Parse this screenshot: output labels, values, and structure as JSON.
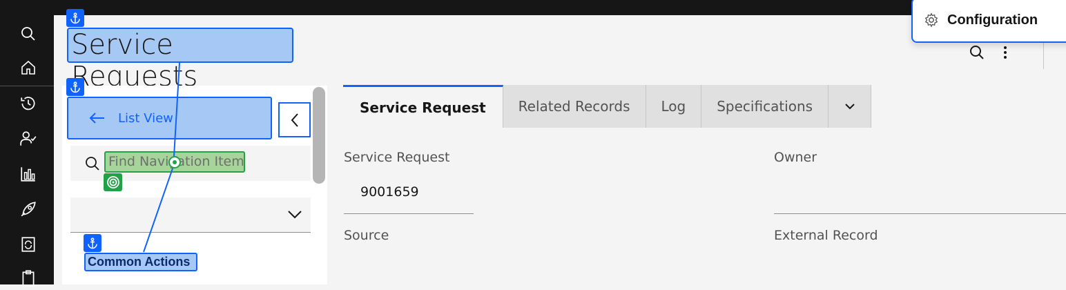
{
  "page": {
    "title": "Service Requests"
  },
  "rail": {
    "icons": [
      "search-icon",
      "home-icon",
      "recent-icon",
      "user-check-icon",
      "report-icon",
      "rocket-icon",
      "refresh-icon",
      "clipboard-icon"
    ]
  },
  "nav": {
    "list_view_label": "List View",
    "search_placeholder": "Find Navigation Item",
    "section_label": "Common Actions"
  },
  "tabs": [
    {
      "label": "Service Request",
      "active": true
    },
    {
      "label": "Related Records",
      "active": false
    },
    {
      "label": "Log",
      "active": false
    },
    {
      "label": "Specifications",
      "active": false
    }
  ],
  "form": {
    "service_request_label": "Service Request",
    "service_request_value": "9001659",
    "owner_label": "Owner",
    "source_label": "Source",
    "external_record_label": "External Record"
  },
  "popup": {
    "label": "Configuration",
    "icon": "gear-icon"
  },
  "colors": {
    "accent": "#0f62fe",
    "highlight_blue": "#a6c8f5",
    "highlight_green": "#a7d49a",
    "target_green": "#24a148"
  }
}
